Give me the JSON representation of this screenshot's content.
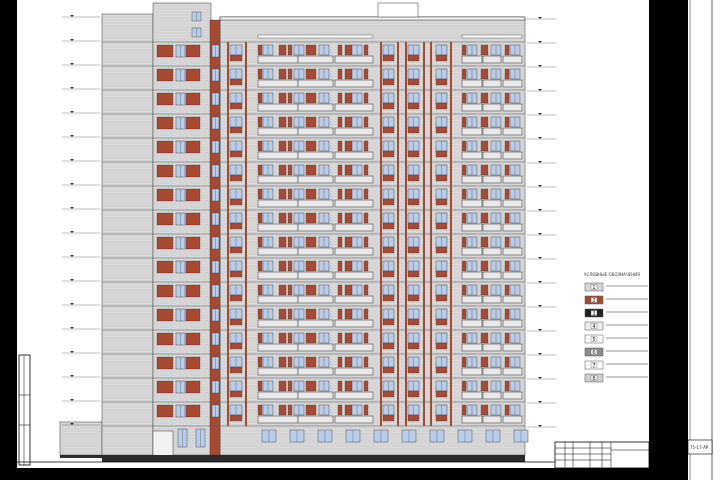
{
  "colors": {
    "sheet": "#ffffff",
    "frame": "#000000",
    "siding": "#d9d9d9",
    "siding_line": "#bdbdbd",
    "brick": "#a84a32",
    "window": "#b8cdea",
    "plinth": "#2b2b2b",
    "line": "#333333"
  },
  "drawing": {
    "residential_floors": 16
  },
  "legend": {
    "title": "УСЛОВНЫЕ ОБОЗНАЧЕНИЯ",
    "items": [
      {
        "num": "1",
        "swatch": "#d6d6d6"
      },
      {
        "num": "2",
        "swatch": "#a84a32"
      },
      {
        "num": "3",
        "swatch": "#222222"
      },
      {
        "num": "4",
        "swatch": "#eeeeee"
      },
      {
        "num": "5",
        "swatch": "#ffffff"
      },
      {
        "num": "6",
        "swatch": "#8c8c8c"
      },
      {
        "num": "7",
        "swatch": "#ffffff"
      },
      {
        "num": "8",
        "swatch": "#cfcfcf"
      }
    ]
  },
  "title_block": {
    "code": "75-17-АР"
  }
}
